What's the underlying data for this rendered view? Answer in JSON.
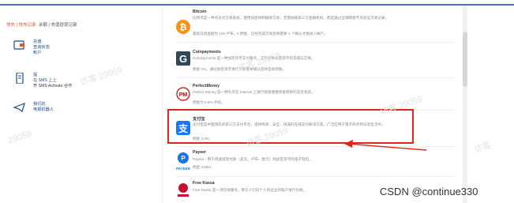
{
  "sidebar": {
    "top_tab_active": "快充 | 快充记录",
    "top_tab_other": "余额 | 充值提现记录",
    "items": [
      {
        "line1": "充值",
        "line2": "查询状态",
        "line3": "帐户",
        "icon": "wallet-icon"
      },
      {
        "line1": "提",
        "line2": "在 SMS 上上",
        "line3": "开 SMS Activate 合作",
        "icon": "phone-icon"
      },
      {
        "line1": "我们的",
        "line2": "电报机器人",
        "icon": "telegram-icon"
      }
    ]
  },
  "payment_methods": [
    {
      "name": "Bitcoin",
      "desc": "比特币是一种点对点交易系统，使用加密体制确保交易，无需依赖第三方金融机构，而是通过全球网络节点验证交易记录。",
      "fee": "最低充值金额为 100 卢布，0 佣金。已经完成交易后将需要 1 个确认才能进入帐户。",
      "icon": "bitcoin-icon",
      "color": "#f7931a"
    },
    {
      "name": "Coinpayments",
      "desc": "Coinpayments 是一种加密货币支付服务，支持多种加密货币的充值与交易。",
      "fee": "佣金 0%。通过加密货币进行交易需要确认后将自动到账。",
      "icon": "coinpayments-icon",
      "color": "#2f4858"
    },
    {
      "name": "PerfectMoney",
      "desc": "Perfect Money 是一种允许在 Internet 上进行快速便捷资金转移的支付系统。",
      "fee": "佣金为 0.5% 手续。",
      "icon": "perfectmoney-icon",
      "color": "#cc0000"
    },
    {
      "name": "支付宝",
      "desc": "支付宝是中国领先的第三方支付平台，提供简单、安全、快速的在线支付解决方案，广泛应用于电子商务和日常生活中。",
      "fee": "佣金 3.3%",
      "icon": "alipay-icon",
      "color": "#1677ff"
    },
    {
      "name": "Payeer",
      "desc": "Payeer - 用于快速接受付款（美元、卢布、欧元）和加密货币的电子钱包。",
      "fee": "佣金 0.95%",
      "icon": "payeer-icon",
      "color": "#1a73e8"
    },
    {
      "name": "Free Kassa",
      "desc": "Free Kassa 是一项在线服务，用于人们向个人和企业的账户进行付款。",
      "fee": "",
      "icon": "freekassa-icon",
      "color": "#c8102e"
    }
  ],
  "watermarks": [
    "访客 29059",
    "访客 29059",
    "访客 29059",
    "29059",
    "访客 29059",
    "访客"
  ],
  "footer_credit": "CSDN @continue330",
  "highlight_color": "#e0261b"
}
